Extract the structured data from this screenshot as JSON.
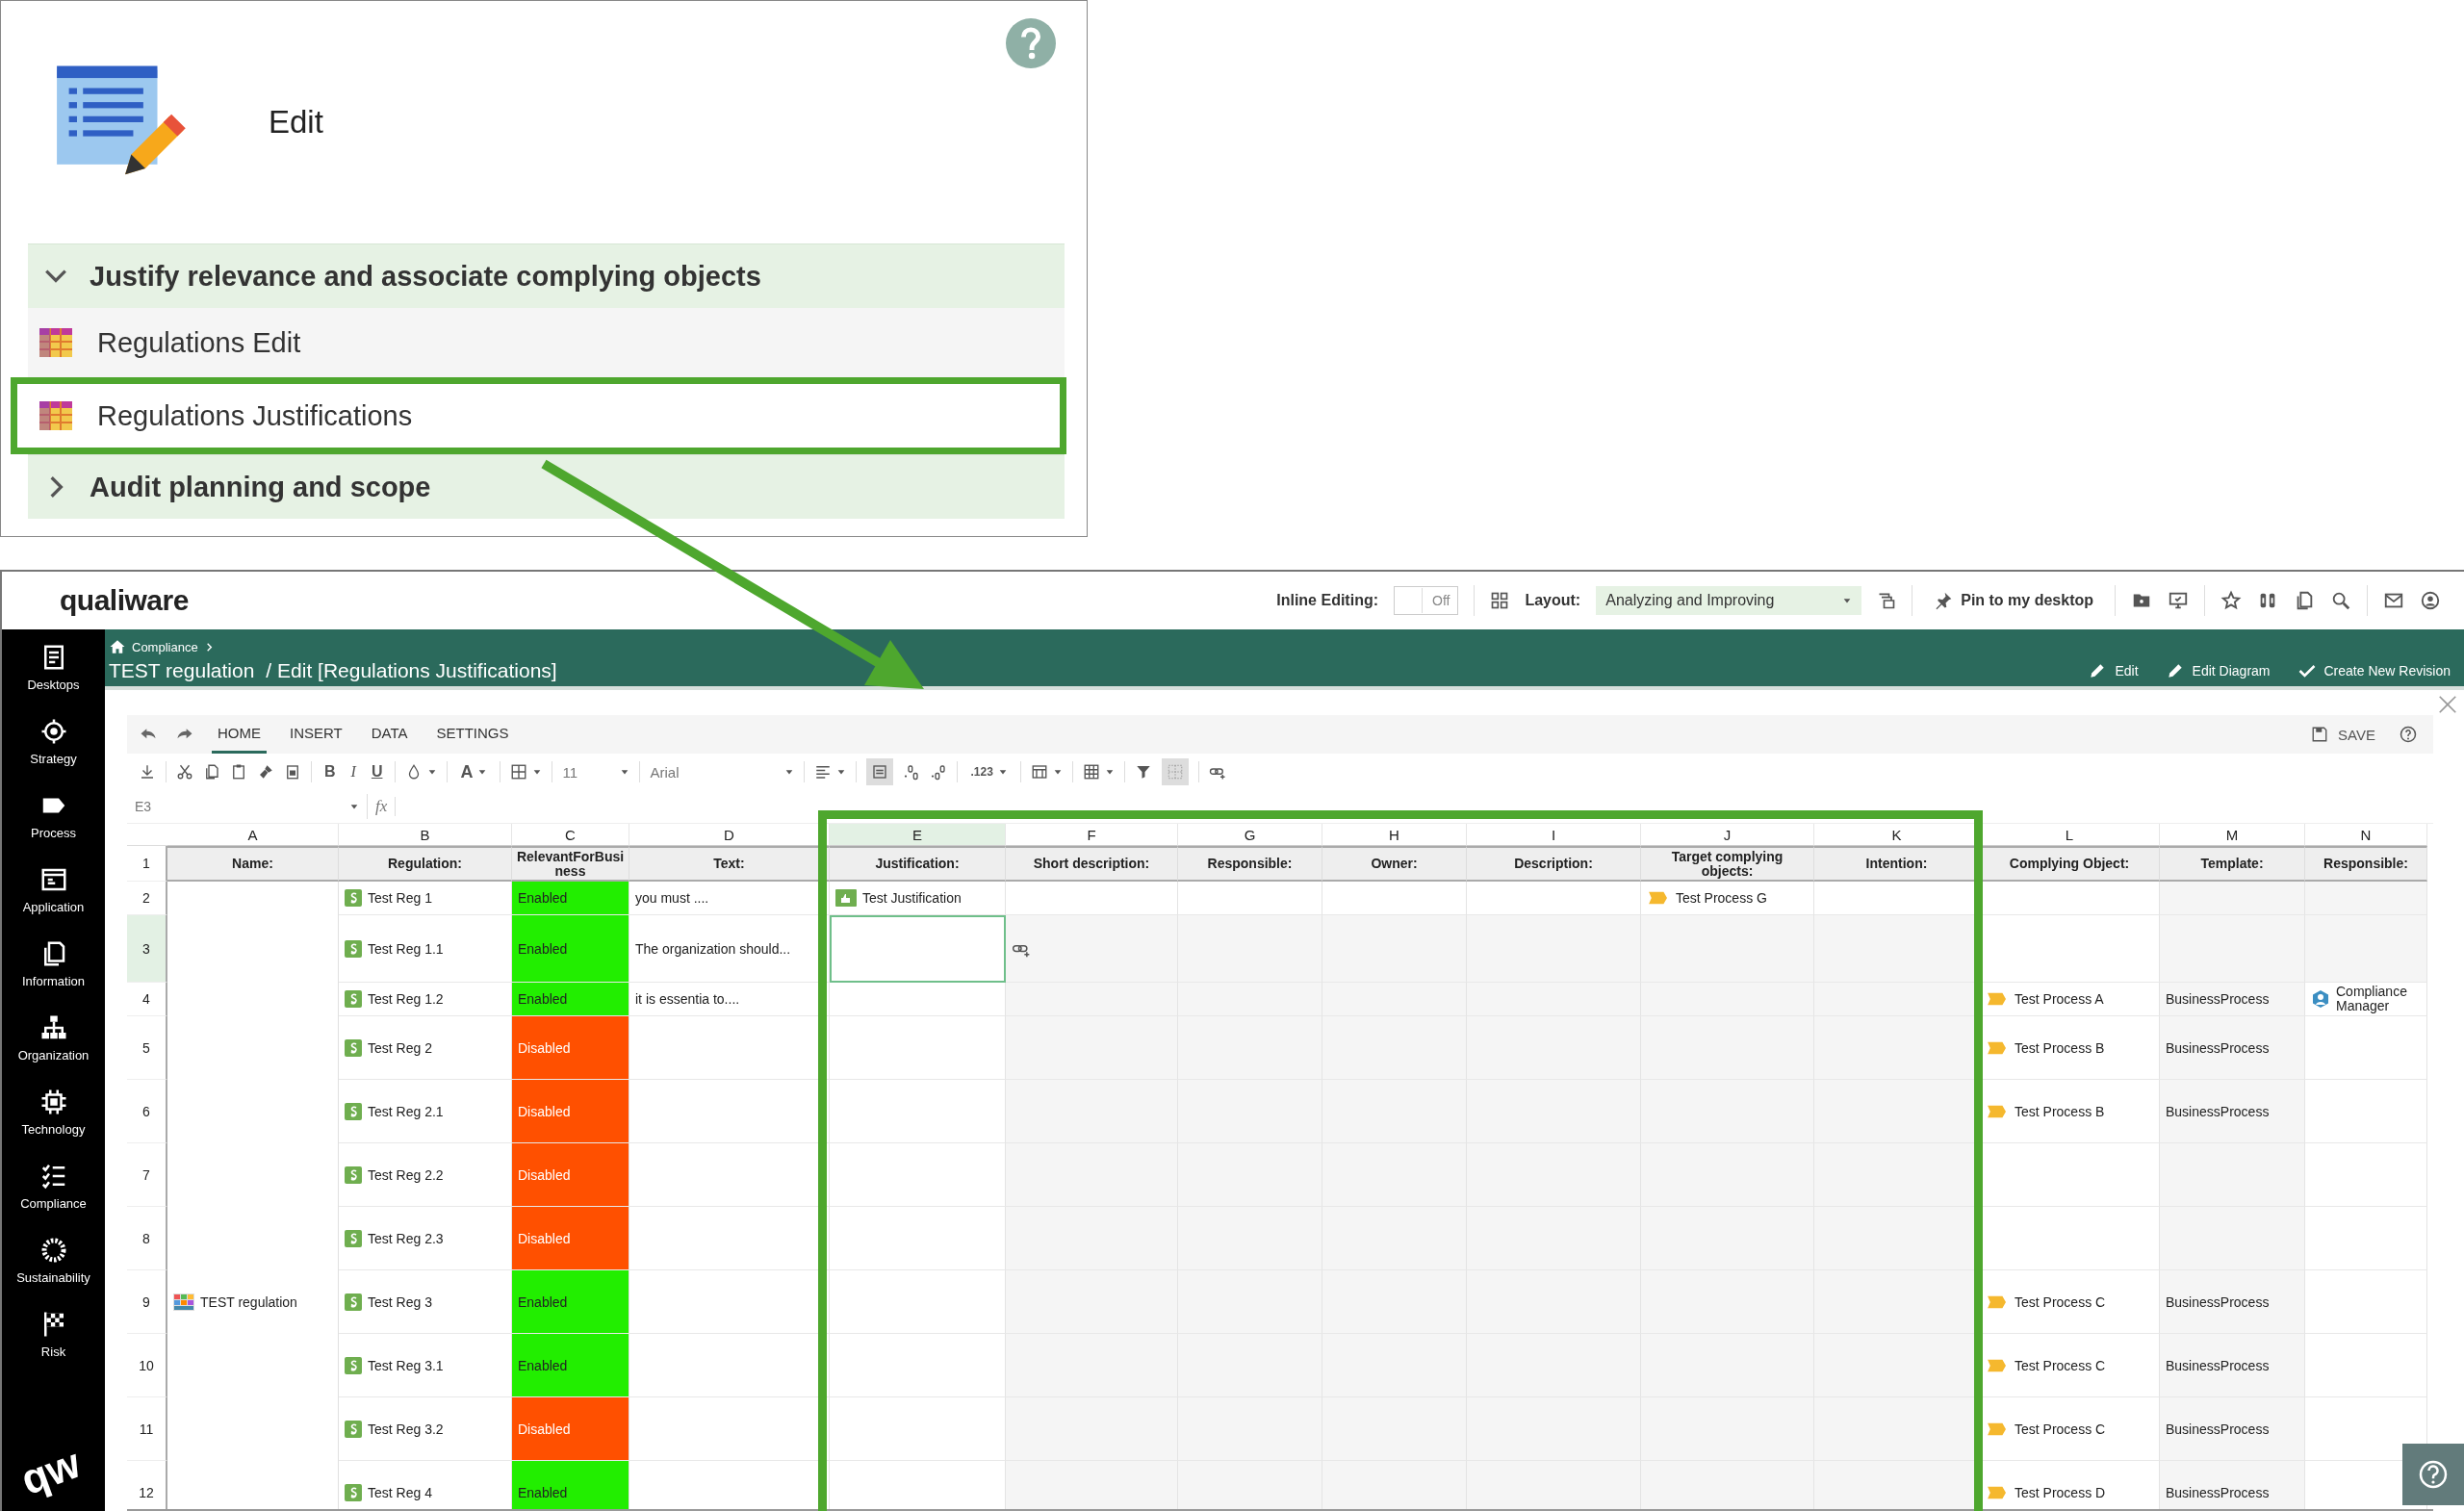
{
  "panel": {
    "title": "Edit",
    "sections": [
      {
        "label": "Justify relevance and associate complying objects",
        "expanded": true,
        "items": [
          {
            "label": "Regulations Edit",
            "selected": false
          },
          {
            "label": "Regulations Justifications",
            "selected": true
          }
        ]
      },
      {
        "label": "Audit planning and scope",
        "expanded": false
      }
    ]
  },
  "app": {
    "logo": "qualiware",
    "logo_mark": "qw",
    "inline_editing": {
      "label": "Inline Editing:",
      "value": "Off",
      "on": false
    },
    "layout": {
      "label": "Layout:",
      "value": "Analyzing and Improving"
    },
    "pin": "Pin to my desktop",
    "breadcrumb": "Compliance",
    "title": "TEST regulation",
    "subtitle": "/ Edit [Regulations Justifications]",
    "actions": [
      "Edit",
      "Edit Diagram",
      "Create New Revision"
    ],
    "sidebar": [
      {
        "label": "Desktops"
      },
      {
        "label": "Strategy"
      },
      {
        "label": "Process"
      },
      {
        "label": "Application"
      },
      {
        "label": "Information"
      },
      {
        "label": "Organization"
      },
      {
        "label": "Technology"
      },
      {
        "label": "Compliance"
      },
      {
        "label": "Sustainability"
      },
      {
        "label": "Risk"
      }
    ]
  },
  "ribbon": {
    "tabs": [
      {
        "label": "HOME",
        "selected": true
      },
      {
        "label": "INSERT",
        "selected": false
      },
      {
        "label": "DATA",
        "selected": false
      },
      {
        "label": "SETTINGS",
        "selected": false
      }
    ],
    "save": "SAVE",
    "bold": "B",
    "italic": "I",
    "underline": "U",
    "font_color": "A",
    "font_size": "11",
    "font": "Arial",
    "number_format": ".123",
    "wrap_text_on": true,
    "gridlines_on": true,
    "cell_ref": "E3",
    "fx": "fx"
  },
  "sheet": {
    "header_row_number": "1",
    "columns": [
      {
        "letter": "A",
        "header": "Name:",
        "selected": false
      },
      {
        "letter": "B",
        "header": "Regulation:",
        "selected": false
      },
      {
        "letter": "C",
        "header": "RelevantForBusiness",
        "selected": false
      },
      {
        "letter": "D",
        "header": "Text:",
        "selected": false
      },
      {
        "letter": "E",
        "header": "Justification:",
        "selected": true
      },
      {
        "letter": "F",
        "header": "Short description:",
        "selected": false
      },
      {
        "letter": "G",
        "header": "Responsible:",
        "selected": false
      },
      {
        "letter": "H",
        "header": "Owner:",
        "selected": false
      },
      {
        "letter": "I",
        "header": "Description:",
        "selected": false
      },
      {
        "letter": "J",
        "header": "Target complying objects:",
        "selected": false
      },
      {
        "letter": "K",
        "header": "Intention:",
        "selected": false
      },
      {
        "letter": "L",
        "header": "Complying Object:",
        "selected": false
      },
      {
        "letter": "M",
        "header": "Template:",
        "selected": false
      },
      {
        "letter": "N",
        "header": "Responsible:",
        "selected": false
      }
    ],
    "name": "TEST regulation",
    "rows": [
      {
        "number": "2",
        "selected": false,
        "regulation": "Test Reg 1",
        "relevant": {
          "text": "Enabled",
          "enabled": true
        },
        "text": "you must ....",
        "justification": "Test Justification",
        "target": "Test Process G"
      },
      {
        "number": "3",
        "selected": true,
        "regulation": "Test Reg 1.1",
        "relevant": {
          "text": "Enabled",
          "enabled": true
        },
        "text": "The organization should..."
      },
      {
        "number": "4",
        "selected": false,
        "regulation": "Test Reg 1.2",
        "relevant": {
          "text": "Enabled",
          "enabled": true
        },
        "text": "it is essentia to....",
        "complying": "Test Process A",
        "template": "BusinessProcess",
        "responsible": "Compliance Manager"
      },
      {
        "number": "5",
        "selected": false,
        "regulation": "Test Reg 2",
        "relevant": {
          "text": "Disabled",
          "enabled": false
        },
        "complying": "Test Process B",
        "template": "BusinessProcess"
      },
      {
        "number": "6",
        "selected": false,
        "regulation": "Test Reg 2.1",
        "relevant": {
          "text": "Disabled",
          "enabled": false
        },
        "complying": "Test Process B",
        "template": "BusinessProcess"
      },
      {
        "number": "7",
        "selected": false,
        "regulation": "Test Reg 2.2",
        "relevant": {
          "text": "Disabled",
          "enabled": false
        }
      },
      {
        "number": "8",
        "selected": false,
        "regulation": "Test Reg 2.3",
        "relevant": {
          "text": "Disabled",
          "enabled": false
        }
      },
      {
        "number": "9",
        "selected": false,
        "regulation": "Test Reg 3",
        "relevant": {
          "text": "Enabled",
          "enabled": true
        },
        "complying": "Test Process C",
        "template": "BusinessProcess"
      },
      {
        "number": "10",
        "selected": false,
        "regulation": "Test Reg 3.1",
        "relevant": {
          "text": "Enabled",
          "enabled": true
        },
        "complying": "Test Process C",
        "template": "BusinessProcess"
      },
      {
        "number": "11",
        "selected": false,
        "regulation": "Test Reg 3.2",
        "relevant": {
          "text": "Disabled",
          "enabled": false
        },
        "complying": "Test Process C",
        "template": "BusinessProcess"
      },
      {
        "number": "12",
        "selected": false,
        "regulation": "Test Reg 4",
        "relevant": {
          "text": "Enabled",
          "enabled": true
        },
        "complying": "Test Process D",
        "template": "BusinessProcess"
      }
    ]
  }
}
